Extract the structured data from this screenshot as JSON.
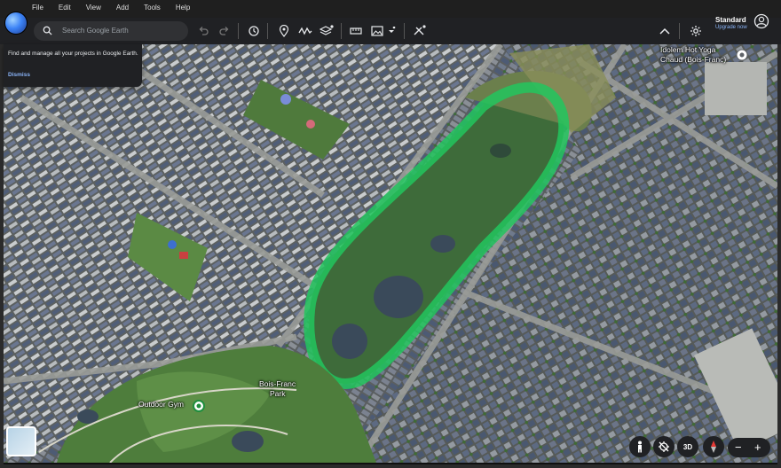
{
  "menu": {
    "file": "File",
    "edit": "Edit",
    "view": "View",
    "add": "Add",
    "tools": "Tools",
    "help": "Help"
  },
  "search": {
    "placeholder": "Search Google Earth"
  },
  "toolbar": {
    "icons": [
      "undo-icon",
      "redo-icon",
      "history-icon",
      "pin-icon",
      "path-icon",
      "layers-icon",
      "ruler-icon",
      "image-icon",
      "satellite-off-icon",
      "chevron-up-icon"
    ]
  },
  "account": {
    "plan": "Standard",
    "upgrade": "Upgrade now"
  },
  "tooltip": {
    "message": "Find and manage all your projects in Google Earth.",
    "dismiss": "Dismiss"
  },
  "map": {
    "labels": {
      "poi_yoga": "Idolem Hot Yoga",
      "poi_yoga_sub": "Chaud (Bois-Franc)",
      "park": "Bois-Franc",
      "park_sub": "Park",
      "gym": "Outdoor Gym"
    },
    "colors": {
      "path_highlight": "#22c55e",
      "water": "#3a4a5a",
      "vegetation": "#3e6b3a"
    }
  },
  "controls": {
    "three_d": "3D",
    "zoom_out": "−",
    "zoom_in": "+"
  }
}
